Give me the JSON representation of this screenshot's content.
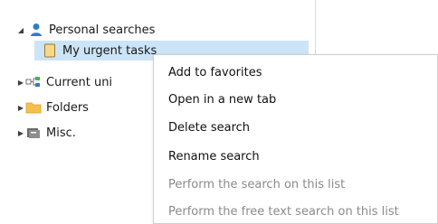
{
  "tree": {
    "items": [
      {
        "label": "Personal searches",
        "icon": "user-icon",
        "expanded": true
      },
      {
        "label": "My urgent tasks",
        "icon": "note-icon",
        "selected": true
      },
      {
        "label": "Current uni",
        "icon": "network-icon",
        "expanded": false
      },
      {
        "label": "Folders",
        "icon": "folder-icon",
        "expanded": false
      },
      {
        "label": "Misc.",
        "icon": "misc-icon",
        "expanded": false
      }
    ]
  },
  "context_menu": {
    "items": [
      {
        "label": "Add to favorites",
        "enabled": true
      },
      {
        "label": "Open in a new tab",
        "enabled": true
      },
      {
        "label": "Delete search",
        "enabled": true
      },
      {
        "label": "Rename search",
        "enabled": true
      },
      {
        "label": "Perform the search on this list",
        "enabled": false
      },
      {
        "label": "Perform the free text search on this list",
        "enabled": false
      }
    ]
  },
  "colors": {
    "selection": "#cce4f7",
    "folder": "#f5c04a",
    "user_icon": "#2f7cc7",
    "disabled_text": "#8a8a8a"
  }
}
